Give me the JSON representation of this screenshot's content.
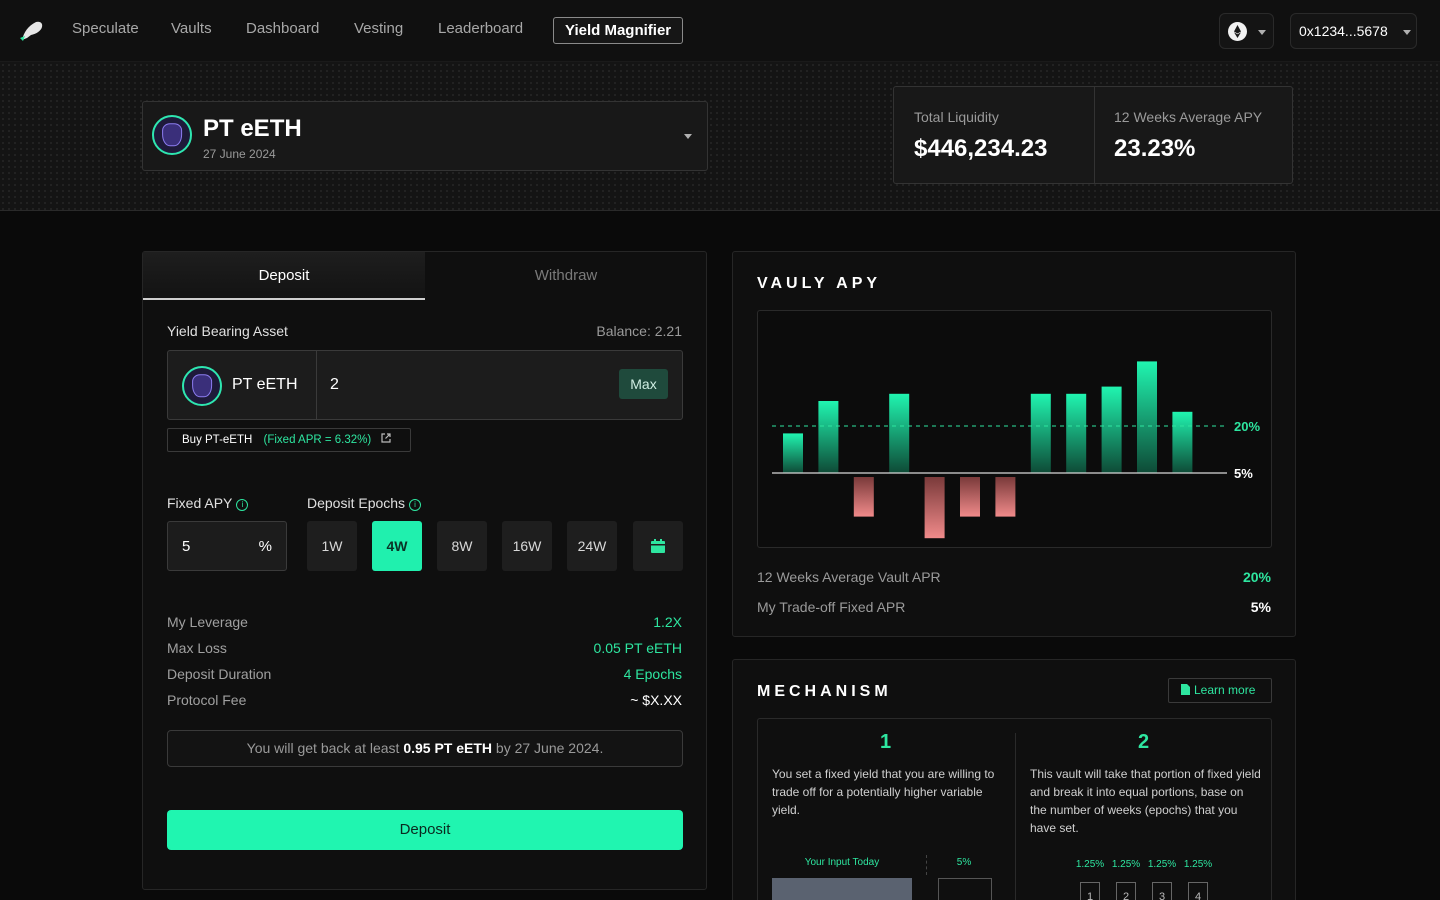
{
  "nav": {
    "items": [
      {
        "label": "Speculate",
        "active": false
      },
      {
        "label": "Vaults",
        "active": false
      },
      {
        "label": "Dashboard",
        "active": false
      },
      {
        "label": "Vesting",
        "active": false
      },
      {
        "label": "Leaderboard",
        "active": false
      },
      {
        "label": "Yield Magnifier",
        "active": true
      }
    ],
    "wallet_address": "0x1234...5678",
    "chain_icon": "ethereum-icon",
    "logo_icon": "bird-logo-icon"
  },
  "asset": {
    "title": "PT eETH",
    "subtitle": "27 June 2024",
    "icon": "pt-eeth-token-icon"
  },
  "stats": {
    "total_liquidity_label": "Total Liquidity",
    "total_liquidity_value": "$446,234.23",
    "avg_apy_label": "12 Weeks Average APY",
    "avg_apy_value": "23.23%"
  },
  "form": {
    "tabs": [
      {
        "label": "Deposit",
        "active": true
      },
      {
        "label": "Withdraw",
        "active": false
      }
    ],
    "yield_asset_label": "Yield Bearing Asset",
    "balance": "Balance: 2.21",
    "token_name": "PT eETH",
    "amount": "2",
    "max_label": "Max",
    "buy_label": "Buy PT-eETH",
    "buy_apr": "(Fixed APR = 6.32%)",
    "fixed_apy_label": "Fixed APY",
    "fixed_apy_value": "5",
    "fixed_apy_unit": "%",
    "epochs_label": "Deposit Epochs",
    "epochs": [
      {
        "label": "1W",
        "active": false
      },
      {
        "label": "4W",
        "active": true
      },
      {
        "label": "8W",
        "active": false
      },
      {
        "label": "16W",
        "active": false
      },
      {
        "label": "24W",
        "active": false
      }
    ],
    "details": [
      {
        "label": "My Leverage",
        "value": "1.2X"
      },
      {
        "label": "Max Loss",
        "value": "0.05 PT eETH"
      },
      {
        "label": "Deposit Duration",
        "value": "4 Epochs"
      },
      {
        "label": "Protocol Fee",
        "value": "~ $X.XX"
      }
    ],
    "summary_prefix": "You will get back at least",
    "summary_amount": "0.95 PT eETH",
    "summary_suffix": "by 27 June 2024.",
    "deposit_button": "Deposit",
    "colors": {
      "accent": "#20f5b0",
      "positive": "#2ee6a0",
      "negative": "#f08a8a"
    }
  },
  "vauly": {
    "title": "VAULY APY",
    "chart_data": {
      "type": "bar",
      "values": [
        11,
        20,
        -11,
        22,
        -17,
        -11,
        -11,
        22,
        22,
        24,
        31,
        17
      ],
      "reference_lines": [
        {
          "label": "20%",
          "style": "dashed"
        },
        {
          "label": "5%",
          "style": "solid"
        }
      ]
    },
    "vault_apr_label": "12 Weeks Average Vault APR",
    "vault_apr_value": "20%",
    "fixed_apr_label": "My Trade-off Fixed APR",
    "fixed_apr_value": "5%"
  },
  "mechanism": {
    "title": "MECHANISM",
    "learn_more": "Learn more",
    "steps": [
      {
        "num": "1",
        "text": "You set a fixed yield that you are willing to trade off for a potentially higher variable yield."
      },
      {
        "num": "2",
        "text": "This vault will take that portion of fixed yield and break it into equal portions, base on the number of weeks (epochs) that you have set."
      }
    ],
    "input_today_label": "Your Input Today",
    "input_pct": "5%",
    "portions": [
      "1.25%",
      "1.25%",
      "1.25%",
      "1.25%"
    ],
    "portion_numbers": [
      "1",
      "2",
      "3",
      "4"
    ]
  }
}
